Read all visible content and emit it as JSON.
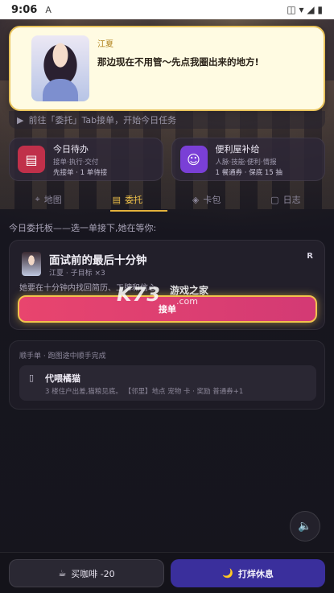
{
  "status_bar": {
    "time": "9:06",
    "left_icon": "A",
    "right_icons": [
      "vibrate-icon",
      "wifi-icon",
      "signal-icon",
      "battery-icon"
    ],
    "right_glyphs": "◫ ▾ ◢ ▮"
  },
  "speech": {
    "speaker": "江夏",
    "line": "那边现在不用管～先点我圈出来的地方!"
  },
  "task_hint": {
    "arrow": "▶",
    "text": "前往「委托」Tab接单，开始今日任务"
  },
  "quick_cards": [
    {
      "title": "今日待办",
      "sub": "接单·执行·交付",
      "sub2": "先接单 · 1 单待接",
      "icon": "clipboard-icon",
      "glyph": "▤"
    },
    {
      "title": "便利屋补给",
      "sub": "人脉·技能·便利·情报",
      "sub2": "1 餐通券 · 保底 15 抽",
      "icon": "people-icon",
      "glyph": "☺"
    }
  ],
  "tabs": [
    {
      "label": "地图",
      "icon": "map-pin-icon",
      "glyph": "⌖"
    },
    {
      "label": "委托",
      "icon": "clipboard-icon",
      "glyph": "▤"
    },
    {
      "label": "卡包",
      "icon": "cube-icon",
      "glyph": "◈"
    },
    {
      "label": "日志",
      "icon": "log-icon",
      "glyph": "▢"
    }
  ],
  "intro": "今日委托板——选一单接下,她在等你:",
  "mission": {
    "title": "面试前的最后十分钟",
    "meta": "江夏 · 子目标 ×3",
    "rank": "R",
    "desc": "她要在十分钟内找回简历、工牌和信心",
    "accept_label": "接单"
  },
  "watermark": {
    "big": "K73",
    "zh": "游戏之家",
    "com": ".com"
  },
  "side_task": {
    "header": "顺手单 · 跑图途中顺手完成",
    "icon_glyph": "▯",
    "title": "代喂橘猫",
    "desc": "3 楼住户出差,猫粮见底。 【邻里】地点 宠物 卡 · 奖励 普通券+1"
  },
  "sound": {
    "glyph": "🔈"
  },
  "bottom": {
    "coffee_glyph": "☕",
    "coffee_label": "买咖啡 -20",
    "rest_glyph": "🌙",
    "rest_label": "打烊休息"
  }
}
